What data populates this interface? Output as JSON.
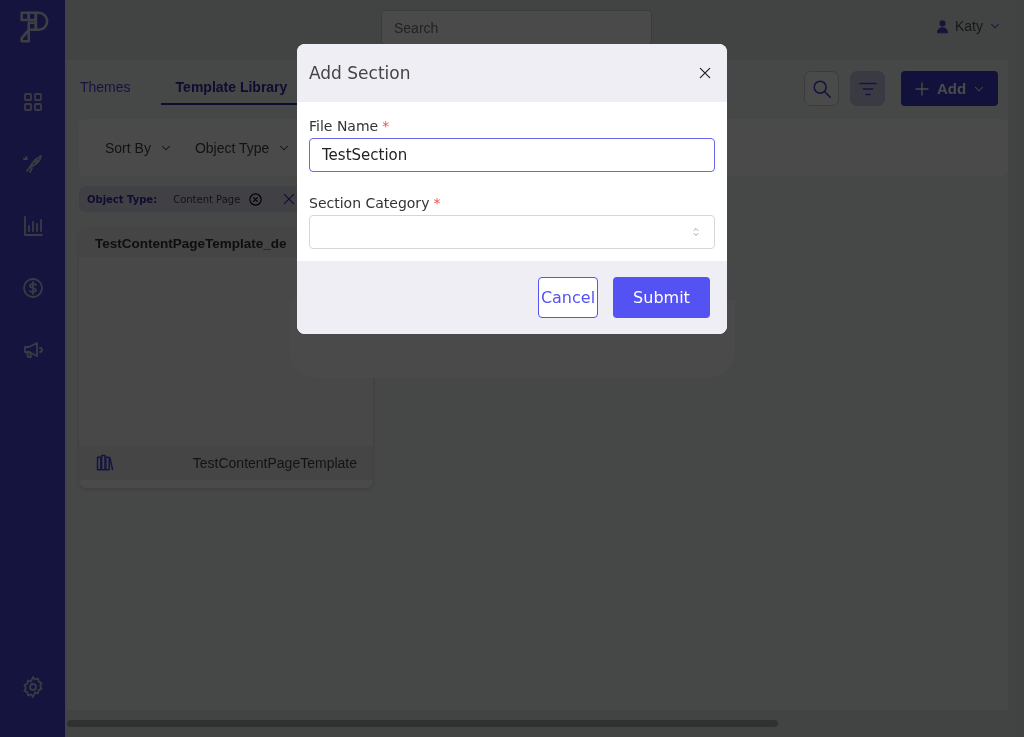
{
  "header": {
    "search": {
      "placeholder": "Search"
    },
    "user": "Katy"
  },
  "tabs": [
    {
      "label": "Themes",
      "selected": false
    },
    {
      "label": "Template Library",
      "selected": true
    }
  ],
  "toolbar": {
    "filter_active": true,
    "add_label": "Add"
  },
  "filters": [
    "Sort By",
    "Object Type"
  ],
  "active_filter": {
    "label": "Object Type:",
    "value": "Content Page"
  },
  "cards": [
    {
      "title": "TestContentPageTemplate_de",
      "name": "TestContentPageTemplate"
    }
  ],
  "dialog": {
    "title": "Add Section",
    "fields": [
      {
        "kind": "text",
        "label": "File Name",
        "required_mark": "*",
        "value": "TestSection",
        "focused": true
      },
      {
        "kind": "select",
        "label": "Section Category",
        "required_mark": "*",
        "focused": false
      }
    ],
    "buttons": [
      {
        "kind": "secondary",
        "label": "Cancel"
      },
      {
        "kind": "primary",
        "label": "Submit"
      }
    ]
  }
}
